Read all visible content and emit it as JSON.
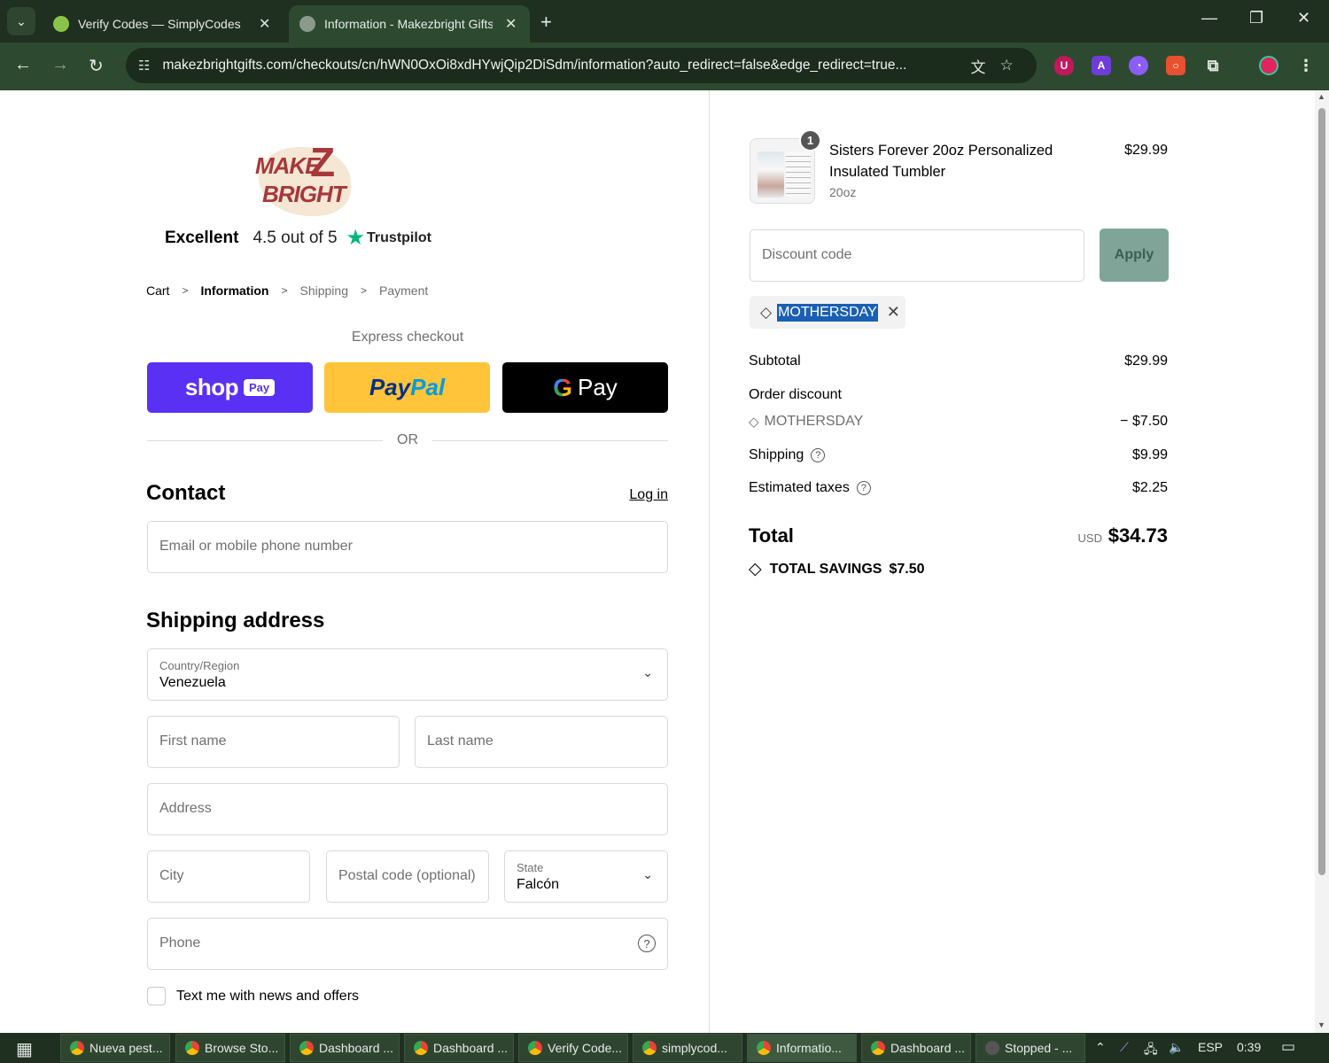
{
  "browser": {
    "tabs": [
      {
        "title": "Verify Codes — SimplyCodes",
        "active": false
      },
      {
        "title": "Information - Makezbright Gifts",
        "active": true
      }
    ],
    "url": "makezbrightgifts.com/checkouts/cn/hWN0OxOi8xdHYwjQip2DiSdm/information?auto_redirect=false&edge_redirect=true..."
  },
  "trustpilot": {
    "rating_word": "Excellent",
    "score": "4.5 out of 5",
    "brand": "Trustpilot"
  },
  "breadcrumb": {
    "cart": "Cart",
    "information": "Information",
    "shipping": "Shipping",
    "payment": "Payment"
  },
  "express": {
    "label": "Express checkout",
    "shop_word": "shop",
    "shop_pay_badge": "Pay",
    "paypal_a": "Pay",
    "paypal_b": "Pal",
    "gpay_g": "G",
    "gpay_word": "Pay",
    "or": "OR"
  },
  "contact": {
    "title": "Contact",
    "login": "Log in",
    "email_placeholder": "Email or mobile phone number"
  },
  "shipping": {
    "title": "Shipping address",
    "country_label": "Country/Region",
    "country_value": "Venezuela",
    "first_name": "First name",
    "last_name": "Last name",
    "address": "Address",
    "city": "City",
    "postal": "Postal code (optional)",
    "state_label": "State",
    "state_value": "Falcón",
    "phone": "Phone",
    "sms_optin": "Text me with news and offers"
  },
  "order": {
    "quantity": "1",
    "product_name": "Sisters Forever 20oz Personalized Insulated Tumbler",
    "variant": "20oz",
    "price": "$29.99",
    "discount_placeholder": "Discount code",
    "apply": "Apply",
    "applied_code": "MOTHERSDAY",
    "subtotal_label": "Subtotal",
    "subtotal": "$29.99",
    "order_discount_label": "Order discount",
    "discount_code": "MOTHERSDAY",
    "discount_amount": "− $7.50",
    "shipping_label": "Shipping",
    "shipping": "$9.99",
    "taxes_label": "Estimated taxes",
    "taxes": "$2.25",
    "total_label": "Total",
    "currency": "USD",
    "total": "$34.73",
    "savings_label": "TOTAL SAVINGS",
    "savings": "$7.50"
  },
  "taskbar": {
    "items": [
      {
        "title": "Nueva pest..."
      },
      {
        "title": "Browse Sto..."
      },
      {
        "title": "Dashboard ..."
      },
      {
        "title": "Dashboard ..."
      },
      {
        "title": "Verify Code..."
      },
      {
        "title": "simplycod..."
      },
      {
        "title": "Informatio..."
      },
      {
        "title": "Dashboard ..."
      },
      {
        "title": "Stopped - ..."
      }
    ],
    "language": "ESP",
    "clock": "0:39"
  },
  "colors": {
    "chrome_dark": "#1f3020",
    "chrome": "#2d4a30",
    "shop_pay": "#5a31f4",
    "paypal": "#ffc439",
    "apply": "#7fa599",
    "trustpilot_star": "#00b67a"
  }
}
